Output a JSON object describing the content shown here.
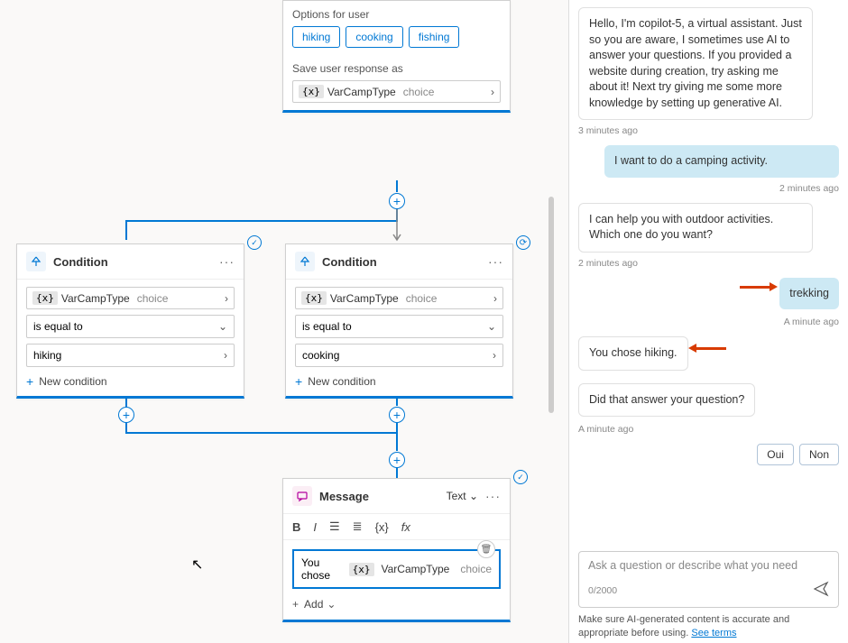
{
  "options_card": {
    "options_label": "Options for user",
    "chips": [
      "hiking",
      "cooking",
      "fishing"
    ],
    "save_label": "Save user response as",
    "var_tag": "{x}",
    "var_name": "VarCampType",
    "var_type": "choice"
  },
  "cond1": {
    "title": "Condition",
    "var_tag": "{x}",
    "var_name": "VarCampType",
    "var_type": "choice",
    "op": "is equal to",
    "value": "hiking",
    "newcond": "New condition"
  },
  "cond2": {
    "title": "Condition",
    "var_tag": "{x}",
    "var_name": "VarCampType",
    "var_type": "choice",
    "op": "is equal to",
    "value": "cooking",
    "newcond": "New condition"
  },
  "msg_card": {
    "title": "Message",
    "mode": "Text",
    "prefix": "You chose",
    "var_tag": "{x}",
    "var_name": "VarCampType",
    "var_type": "choice",
    "add": "Add"
  },
  "toolbar": {
    "bold": "B",
    "italic": "I",
    "vartag": "{x}",
    "fx": "fx"
  },
  "chat": {
    "b1": "Hello, I'm copilot-5, a virtual assistant. Just so you are aware, I sometimes use AI to answer your questions. If you provided a website during creation, try asking me about it! Next try giving me some more knowledge by setting up generative AI.",
    "t1": "3 minutes ago",
    "u1": "I want to do a camping activity.",
    "t2": "2 minutes ago",
    "b2": "I can help you with outdoor activities. Which one do you want?",
    "t3": "2 minutes ago",
    "u2": "trekking",
    "t4": "A minute ago",
    "b3": "You chose hiking.",
    "b4": "Did that answer your question?",
    "t5": "A minute ago",
    "qr1": "Oui",
    "qr2": "Non",
    "placeholder": "Ask a question or describe what you need",
    "count": "0/2000",
    "footer_a": "Make sure AI-generated content is accurate and appropriate before using. ",
    "footer_link": "See terms"
  }
}
